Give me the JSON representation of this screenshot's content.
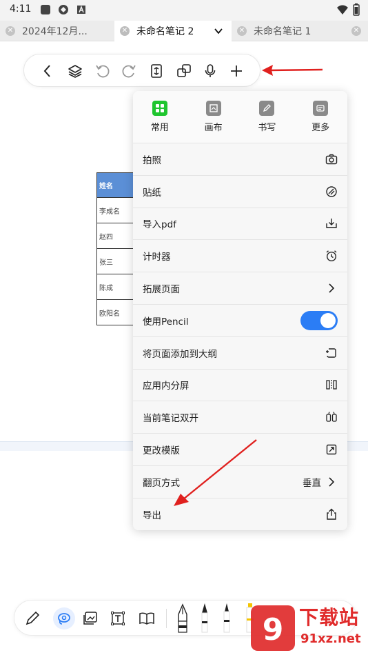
{
  "status_bar": {
    "time": "4:11"
  },
  "tabs": [
    {
      "label": "2024年12月...",
      "active": false
    },
    {
      "label": "未命名笔记 2",
      "active": true
    },
    {
      "label": "未命名笔记 1",
      "active": false
    }
  ],
  "background_table": {
    "header": "姓名",
    "rows": [
      "李成名",
      "赵四",
      "张三",
      "陈成",
      "欧阳名"
    ]
  },
  "menu": {
    "categories": [
      {
        "label": "常用",
        "icon": "grid-icon"
      },
      {
        "label": "画布",
        "icon": "canvas-icon"
      },
      {
        "label": "书写",
        "icon": "pen-icon"
      },
      {
        "label": "更多",
        "icon": "more-icon"
      }
    ],
    "items": [
      {
        "label": "拍照",
        "icon": "camera-icon"
      },
      {
        "label": "贴纸",
        "icon": "sticker-icon"
      },
      {
        "label": "导入pdf",
        "icon": "import-icon"
      },
      {
        "label": "计时器",
        "icon": "alarm-icon"
      },
      {
        "label": "拓展页面",
        "icon": "chevron-right-icon"
      },
      {
        "label": "使用Pencil",
        "toggle": true
      },
      {
        "label": "将页面添加到大纲",
        "icon": "outline-add-icon"
      },
      {
        "label": "应用内分屏",
        "icon": "split-screen-icon"
      },
      {
        "label": "当前笔记双开",
        "icon": "dual-open-icon"
      },
      {
        "label": "更改模版",
        "icon": "template-icon"
      },
      {
        "label": "翻页方式",
        "value": "垂直",
        "icon": "chevron-right-icon"
      },
      {
        "label": "导出",
        "icon": "share-icon"
      }
    ]
  },
  "colors": {
    "accent": "#2b7df5",
    "arrow": "#e0201e",
    "table_header": "#5b8fd6"
  },
  "watermark": {
    "text": "下载站",
    "url": "91xz.net"
  }
}
